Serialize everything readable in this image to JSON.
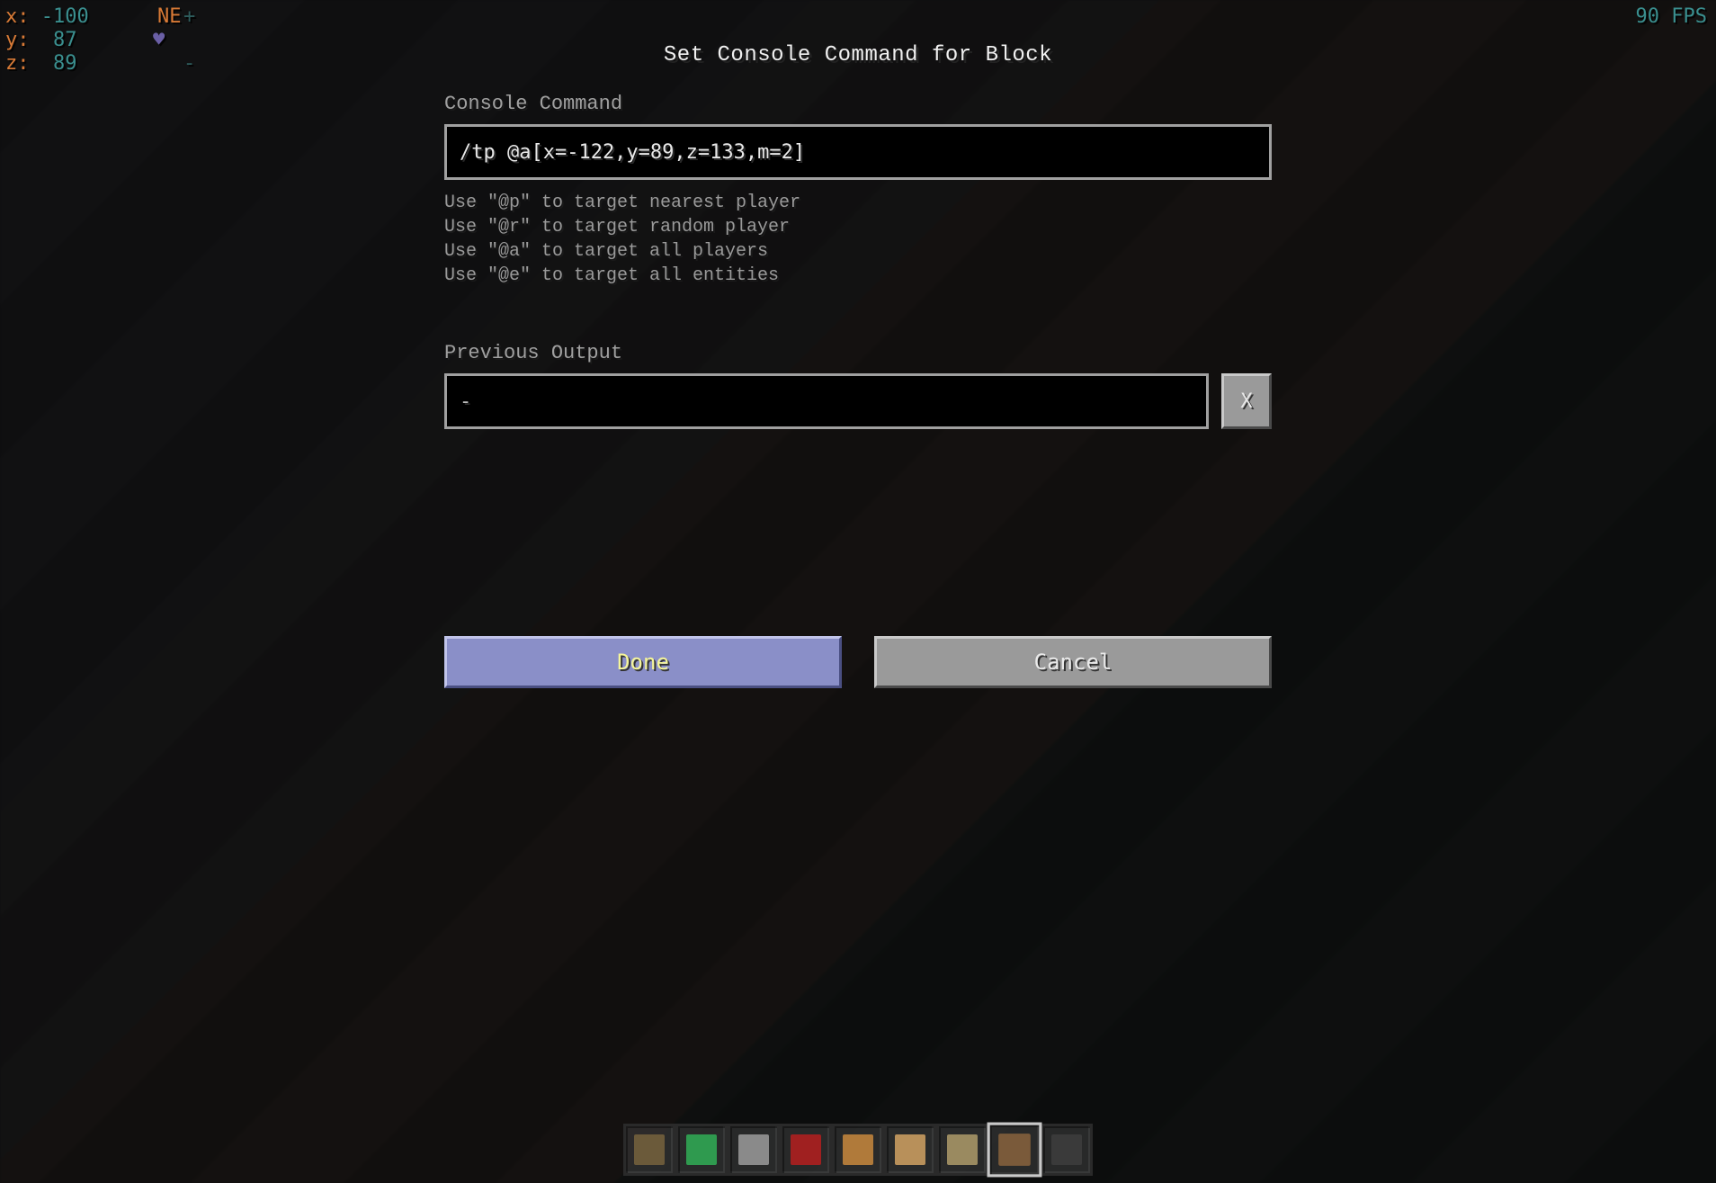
{
  "hud": {
    "coords": {
      "x_label": "x:",
      "x": "-100",
      "y_label": "y:",
      "y": "87",
      "z_label": "z:",
      "z": "89"
    },
    "compass": "NE",
    "plus": "+",
    "minus": "-",
    "fps": "90 FPS"
  },
  "gui": {
    "title": "Set Console Command for Block",
    "command_label": "Console Command",
    "command_value": "/tp @a[x=-122,y=89,z=133,m=2]",
    "hints": [
      "Use \"@p\" to target nearest player",
      "Use \"@r\" to target random player",
      "Use \"@a\" to target all players",
      "Use \"@e\" to target all entities"
    ],
    "prev_label": "Previous Output",
    "prev_value": "-",
    "clear_button": "X",
    "done": "Done",
    "cancel": "Cancel"
  },
  "hotbar": {
    "selected_index": 7,
    "slots": [
      {
        "name": "grass-block",
        "color": "#6b5a3a"
      },
      {
        "name": "emerald-block",
        "color": "#2f9a4f"
      },
      {
        "name": "rail",
        "color": "#8a8a8a"
      },
      {
        "name": "redstone",
        "color": "#a02020"
      },
      {
        "name": "command-block",
        "color": "#b07a3a"
      },
      {
        "name": "command-block-chain",
        "color": "#b8905a"
      },
      {
        "name": "command-block-repeat",
        "color": "#9a8a60"
      },
      {
        "name": "tool",
        "color": "#7a5a3a"
      },
      {
        "name": "empty",
        "color": "#3a3a3a"
      }
    ]
  }
}
